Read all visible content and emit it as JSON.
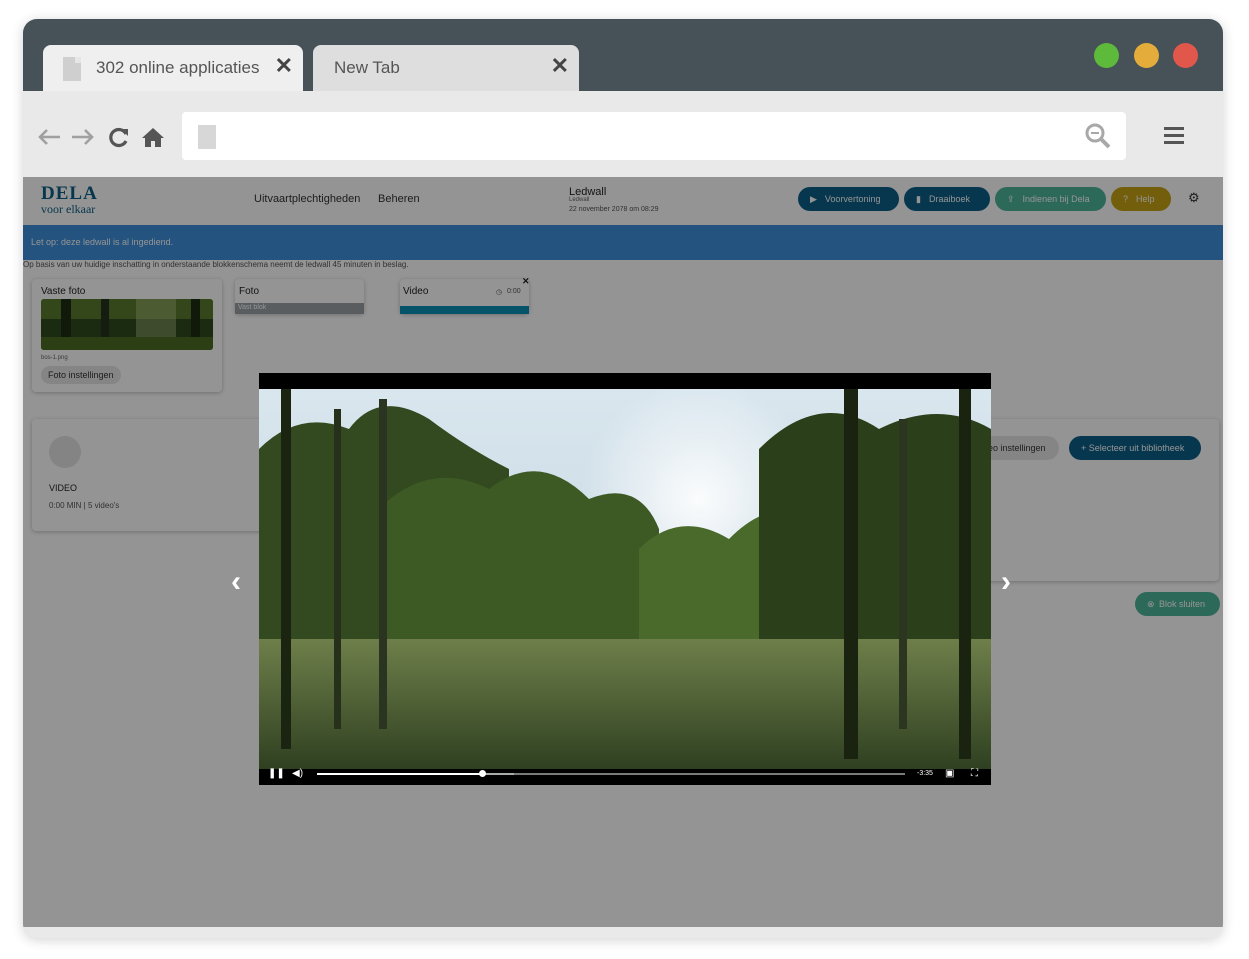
{
  "browser": {
    "tabs": [
      {
        "title": "302 online applicaties",
        "close": "✕"
      },
      {
        "title": "New Tab",
        "close": "✕"
      }
    ],
    "window_controls": {
      "green": "#5dba3b",
      "yellow": "#e4ad3b",
      "red": "#e2574c"
    }
  },
  "app": {
    "logo_line1": "DELA",
    "logo_line2": "voor elkaar",
    "nav": [
      "Uitvaartplechtigheden",
      "Beheren"
    ],
    "ledwall_title": "Ledwall",
    "ledwall_subtitle": "Ledwall",
    "ledwall_date": "22 november 2078 om 08:29",
    "buttons": {
      "preview": "Voorvertoning",
      "script": "Draaiboek",
      "submit": "Indienen bij Dela",
      "help": "Help"
    },
    "notice": "Let op: deze ledwall is al ingediend.",
    "subnote": "Op basis van uw huidige inschatting in onderstaande blokkenschema neemt de ledwall 45 minuten in beslag.",
    "blocks": {
      "fixed_photo": {
        "title": "Vaste foto",
        "filename": "bos-1.png",
        "settings": "Foto instellingen"
      },
      "photo": {
        "title": "Foto",
        "tag": "Vast blok"
      },
      "video": {
        "title": "Video",
        "time": "0:00",
        "close": "✕"
      }
    },
    "video_panel": {
      "label": "VIDEO",
      "meta": "0:00 MIN | 5 video's",
      "settings_partial": "eo instellingen",
      "select_library": "+ Selecteer uit bibliotheek",
      "close_block": "Blok sluiten"
    }
  },
  "player": {
    "remaining": "-3:35",
    "progress": 0.28,
    "buffered": 0.335
  },
  "colors": {
    "primary_dark": "#0c5f87",
    "teal_green": "#4fb59a",
    "help_yellow": "#c6a314",
    "notice_blue": "#3d8fd9"
  }
}
